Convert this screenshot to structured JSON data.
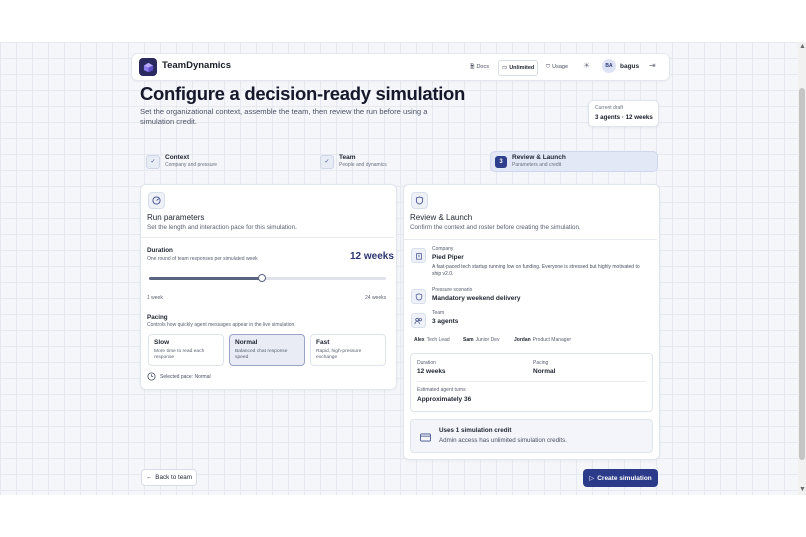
{
  "app": {
    "name": "TeamDynamics"
  },
  "nav": {
    "docs": "Docs",
    "unlimited": "Unlimited",
    "usage": "Usage",
    "user_initials": "BA",
    "username": "bagus"
  },
  "hero": {
    "title": "Configure a decision-ready simulation",
    "subtitle": "Set the organizational context, assemble the team, then review the run before using a simulation credit."
  },
  "draft": {
    "label": "Current draft",
    "value": "3 agents · 12 weeks"
  },
  "steps": [
    {
      "num": "1",
      "title": "Context",
      "sub": "Company and pressure",
      "state": "done"
    },
    {
      "num": "2",
      "title": "Team",
      "sub": "People and dynamics",
      "state": "done"
    },
    {
      "num": "3",
      "title": "Review & Launch",
      "sub": "Parameters and credit",
      "state": "current"
    }
  ],
  "run": {
    "title": "Run parameters",
    "subtitle": "Set the length and interaction pace for this simulation.",
    "duration_label": "Duration",
    "duration_sub": "One round of team responses per simulated week",
    "duration_value": "12 weeks",
    "slider": {
      "min": 1,
      "max": 24,
      "value": 12
    },
    "min_label": "1 week",
    "max_label": "24 weeks",
    "pacing_label": "Pacing",
    "pacing_sub": "Controls how quickly agent messages appear in the live simulation.",
    "pace_options": [
      {
        "name": "Slow",
        "desc": "More time to read each response",
        "selected": false
      },
      {
        "name": "Normal",
        "desc": "Balanced chat response speed",
        "selected": true
      },
      {
        "name": "Fast",
        "desc": "Rapid, high-pressure exchange",
        "selected": false
      }
    ],
    "selected_pace": "Selected pace: Normal"
  },
  "review": {
    "title": "Review & Launch",
    "subtitle": "Confirm the context and roster before creating the simulation.",
    "company_label": "Company",
    "company_name": "Pied Piper",
    "company_desc": "A fast-paced tech startup running low on funding. Everyone is stressed but highly motivated to ship v2.0.",
    "scenario_label": "Pressure scenario",
    "scenario_value": "Mandatory weekend delivery",
    "team_label": "Team",
    "team_value": "3 agents",
    "members": [
      {
        "name": "Alex",
        "role": "Tech Lead"
      },
      {
        "name": "Sam",
        "role": "Junior Dev"
      },
      {
        "name": "Jordan",
        "role": "Product Manager"
      }
    ],
    "stats": {
      "duration_label": "Duration",
      "duration_value": "12 weeks",
      "pacing_label": "Pacing",
      "pacing_value": "Normal",
      "turns_label": "Estimated agent turns",
      "turns_value": "Approximately 36"
    },
    "credit_title": "Uses 1 simulation credit",
    "credit_sub": "Admin access has unlimited simulation credits."
  },
  "actions": {
    "back": "Back to team",
    "create": "Create simulation"
  }
}
